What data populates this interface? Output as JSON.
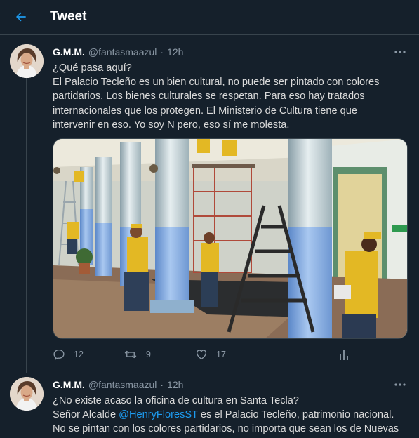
{
  "header": {
    "title": "Tweet",
    "back_icon": "arrow-left-icon"
  },
  "colors": {
    "background": "#15202b",
    "accent": "#1d9bf0",
    "secondary_text": "#8b98a5",
    "divider": "#38444d"
  },
  "tweets": [
    {
      "name": "G.M.M.",
      "handle": "@fantasmaazul",
      "separator": "·",
      "time": "12h",
      "lines": [
        "¿Qué pasa aquí?",
        "El Palacio Tecleño es un bien cultural, no puede ser pintado con colores",
        "partidarios. Los bienes culturales se respetan. Para eso hay tratados",
        "internacionales que los protegen. El Ministerio de Cultura tiene que",
        "intervenir en eso. Yo soy N pero, eso sí me molesta."
      ],
      "actions": {
        "replies": "12",
        "retweets": "9",
        "likes": "17"
      }
    },
    {
      "name": "G.M.M.",
      "handle": "@fantasmaazul",
      "separator": "·",
      "time": "12h",
      "line1": "¿No existe acaso la oficina de cultura en Santa Tecla?",
      "line2_before": "Señor Alcalde ",
      "line2_mention": "@HenryFloresST",
      "line2_after": " es el Palacio Tecleño, patrimonio nacional.",
      "line3": "No se pintan con los colores partidarios, no importa que sean los de Nuevas"
    }
  ]
}
